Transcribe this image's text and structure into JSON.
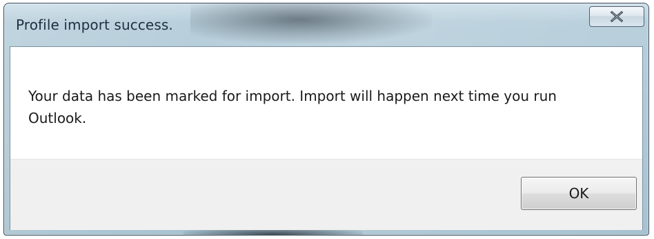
{
  "window": {
    "title": "Profile import success."
  },
  "titlebar": {
    "close_icon": "close-x-icon"
  },
  "message": {
    "text": "Your data has been marked for import. Import will happen next time you run Outlook."
  },
  "buttons": {
    "ok_label": "OK"
  },
  "colors": {
    "frame": "#b9d0dc",
    "client_background": "#ffffff",
    "button_area_background": "#f0f0f0"
  }
}
